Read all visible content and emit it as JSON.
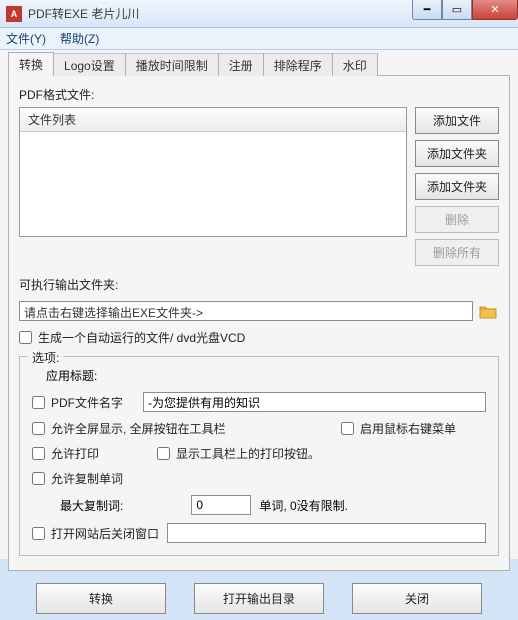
{
  "window": {
    "title": "PDF转EXE  老片儿川"
  },
  "menu": {
    "file": "文件(Y)",
    "help": "帮助(Z)"
  },
  "tabs": [
    "转换",
    "Logo设置",
    "播放时间限制",
    "注册",
    "排除程序",
    "水印"
  ],
  "main": {
    "pdf_files_label": "PDF格式文件:",
    "filelist_header": "文件列表",
    "btn_add_file": "添加文件",
    "btn_add_folder1": "添加文件夹",
    "btn_add_folder2": "添加文件夹",
    "btn_delete": "删除",
    "btn_delete_all": "删除所有",
    "output_label": "可执行输出文件夹:",
    "output_value": "请点击右键选择输出EXE文件夹->",
    "chk_autorun": "生成一个自动运行的文件/ dvd光盘VCD"
  },
  "options": {
    "legend": "选项:",
    "app_title_label": "应用标题:",
    "chk_pdfname": "PDF文件名字",
    "title_input": "-为您提供有用的知识",
    "chk_fullscreen": "允许全屏显示, 全屏按钮在工具栏",
    "chk_mouse_menu": "启用鼠标右键菜单",
    "chk_print": "允许打印",
    "chk_print_btn": "显示工具栏上的打印按钮。",
    "chk_copy": "允许复制单词",
    "max_copy_label": "最大复制词:",
    "max_copy_value": "0",
    "max_copy_unit": "单词, 0没有限制.",
    "chk_close_window": "打开网站后关闭窗口",
    "close_window_value": ""
  },
  "bottom": {
    "convert": "转换",
    "open_dir": "打开输出目录",
    "close": "关闭"
  }
}
